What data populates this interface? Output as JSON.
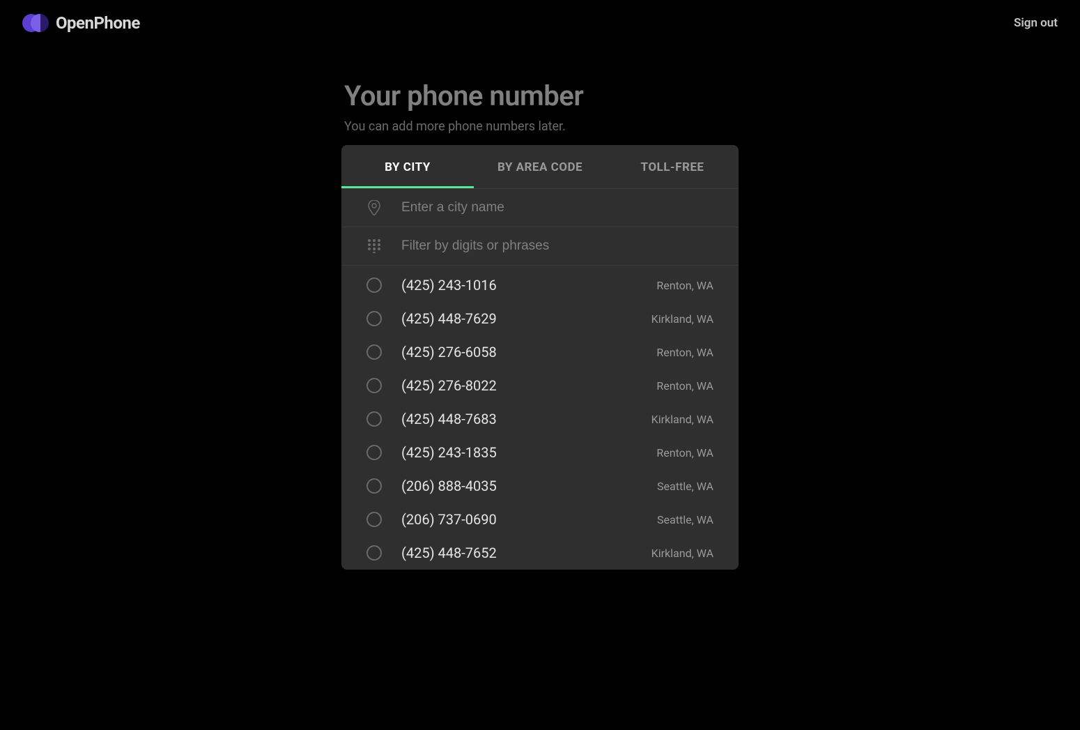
{
  "header": {
    "brand": "OpenPhone",
    "sign_out": "Sign out"
  },
  "page": {
    "title": "Your phone number",
    "subtitle": "You can add more phone numbers later."
  },
  "tabs": [
    {
      "label": "BY CITY",
      "active": true
    },
    {
      "label": "BY AREA CODE",
      "active": false
    },
    {
      "label": "TOLL-FREE",
      "active": false
    }
  ],
  "inputs": {
    "city_placeholder": "Enter a city name",
    "filter_placeholder": "Filter by digits or phrases"
  },
  "numbers": [
    {
      "phone": "(425) 243-1016",
      "location": "Renton, WA"
    },
    {
      "phone": "(425) 448-7629",
      "location": "Kirkland, WA"
    },
    {
      "phone": "(425) 276-6058",
      "location": "Renton, WA"
    },
    {
      "phone": "(425) 276-8022",
      "location": "Renton, WA"
    },
    {
      "phone": "(425) 448-7683",
      "location": "Kirkland, WA"
    },
    {
      "phone": "(425) 243-1835",
      "location": "Renton, WA"
    },
    {
      "phone": "(206) 888-4035",
      "location": "Seattle, WA"
    },
    {
      "phone": "(206) 737-0690",
      "location": "Seattle, WA"
    },
    {
      "phone": "(425) 448-7652",
      "location": "Kirkland, WA"
    }
  ]
}
